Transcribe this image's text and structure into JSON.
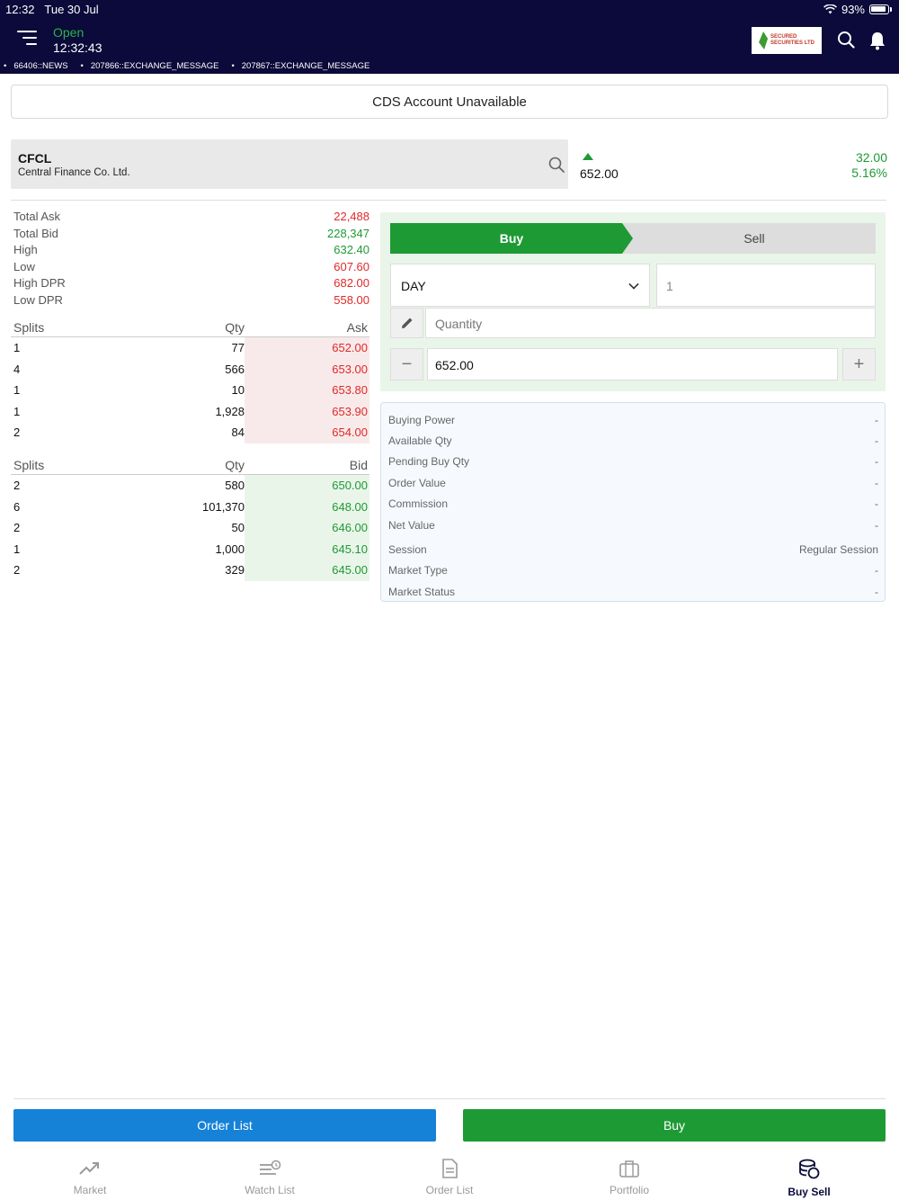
{
  "status_bar": {
    "time": "12:32",
    "date": "Tue 30 Jul",
    "battery": "93%"
  },
  "header": {
    "market_status": "Open",
    "market_time": "12:32:43",
    "logo_text": "SECURED SECURITIES LTD",
    "colors": {
      "background": "#0b0a3a",
      "open": "#2cb34a"
    }
  },
  "ticker": [
    "66406::NEWS",
    "207866::EXCHANGE_MESSAGE",
    "207867::EXCHANGE_MESSAGE"
  ],
  "banner": {
    "text": "CDS Account Unavailable"
  },
  "symbol": {
    "code": "CFCL",
    "name": "Central Finance Co. Ltd.",
    "last_price": "652.00",
    "change": "32.00",
    "change_pct": "5.16%",
    "trend": "up"
  },
  "stats": [
    {
      "label": "Total Ask",
      "value": "22,488",
      "color": "red"
    },
    {
      "label": "Total Bid",
      "value": "228,347",
      "color": "green"
    },
    {
      "label": "High",
      "value": "632.40",
      "color": "green"
    },
    {
      "label": "Low",
      "value": "607.60",
      "color": "red"
    },
    {
      "label": "High DPR",
      "value": "682.00",
      "color": "red"
    },
    {
      "label": "Low DPR",
      "value": "558.00",
      "color": "red"
    }
  ],
  "ask_table": {
    "headers": {
      "splits": "Splits",
      "qty": "Qty",
      "price": "Ask"
    },
    "rows": [
      {
        "splits": "1",
        "qty": "77",
        "price": "652.00"
      },
      {
        "splits": "4",
        "qty": "566",
        "price": "653.00"
      },
      {
        "splits": "1",
        "qty": "10",
        "price": "653.80"
      },
      {
        "splits": "1",
        "qty": "1,928",
        "price": "653.90"
      },
      {
        "splits": "2",
        "qty": "84",
        "price": "654.00"
      }
    ]
  },
  "bid_table": {
    "headers": {
      "splits": "Splits",
      "qty": "Qty",
      "price": "Bid"
    },
    "rows": [
      {
        "splits": "2",
        "qty": "580",
        "price": "650.00"
      },
      {
        "splits": "6",
        "qty": "101,370",
        "price": "648.00"
      },
      {
        "splits": "2",
        "qty": "50",
        "price": "646.00"
      },
      {
        "splits": "1",
        "qty": "1,000",
        "price": "645.10"
      },
      {
        "splits": "2",
        "qty": "329",
        "price": "645.00"
      }
    ]
  },
  "order_form": {
    "tab_buy": "Buy",
    "tab_sell": "Sell",
    "active_side": "Buy",
    "tif": "DAY",
    "days": "1",
    "quantity_placeholder": "Quantity",
    "price": "652.00",
    "minus": "−",
    "plus": "+"
  },
  "summary": [
    {
      "label": "Buying Power",
      "value": "-"
    },
    {
      "label": "Available Qty",
      "value": "-"
    },
    {
      "label": "Pending Buy Qty",
      "value": "-"
    },
    {
      "label": "Order Value",
      "value": "-"
    },
    {
      "label": "Commission",
      "value": "-"
    },
    {
      "label": "Net Value",
      "value": "-"
    },
    {
      "label": "Session",
      "value": "Regular Session"
    },
    {
      "label": "Market Type",
      "value": "-"
    },
    {
      "label": "Market Status",
      "value": "-"
    }
  ],
  "actions": {
    "order_list": "Order List",
    "buy": "Buy"
  },
  "nav": [
    {
      "label": "Market",
      "icon": "trending-up-icon"
    },
    {
      "label": "Watch List",
      "icon": "watch-list-icon"
    },
    {
      "label": "Order List",
      "icon": "document-icon"
    },
    {
      "label": "Portfolio",
      "icon": "briefcase-icon"
    },
    {
      "label": "Buy Sell",
      "icon": "coins-icon",
      "active": true
    }
  ]
}
